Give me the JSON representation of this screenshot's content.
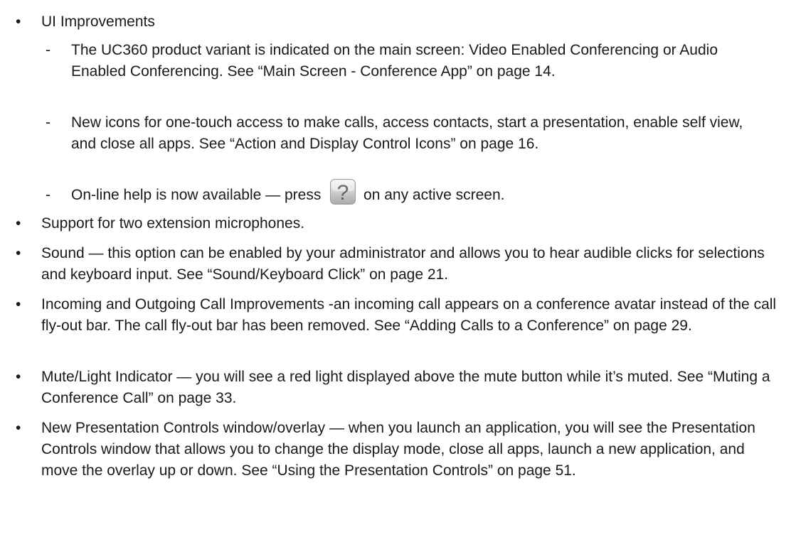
{
  "list": {
    "bullet": "•",
    "dash": "-",
    "item1": {
      "text": "UI Improvements",
      "subitems": [
        {
          "text": "The UC360 product variant is indicated on the main screen: Video Enabled Conferencing or Audio Enabled Conferencing. See “Main Screen - Conference App” on page 14."
        },
        {
          "text": "New icons for one-touch access to make calls, access contacts, start a presentation, enable self view, and close all apps. See “Action and Display Control Icons” on page 16."
        },
        {
          "before": "On-line help is now available — press",
          "after": "on any active screen.",
          "icon": "help-question-icon"
        }
      ]
    },
    "item2": "Support for two extension microphones.",
    "item3": "Sound — this option can be enabled by your administrator and allows you to hear audible clicks for selections and keyboard input. See “Sound/Keyboard Click” on page 21.",
    "item4": "Incoming and Outgoing Call Improvements -an incoming call appears on a conference avatar instead of the call fly-out bar. The call fly-out bar has been removed. See “Adding Calls to a Conference” on page 29.",
    "item5": "Mute/Light Indicator — you will see a red light displayed above the mute button while it’s muted. See “Muting a Conference Call” on page 33.",
    "item6": "New Presentation Controls window/overlay — when you launch an application, you will see the Presentation Controls window that allows you to change the display mode, close all apps, launch a new application, and move the overlay up or down. See “Using the Presentation Controls” on page 51."
  }
}
